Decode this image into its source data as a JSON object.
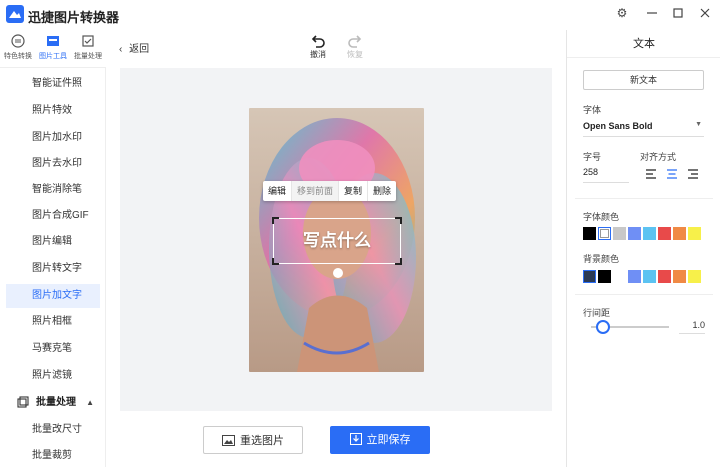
{
  "app": {
    "title": "迅捷图片转换器"
  },
  "tooltabs": [
    {
      "label": "特色转换"
    },
    {
      "label": "图片工具"
    },
    {
      "label": "批量处理"
    }
  ],
  "sidebar": {
    "items": [
      "智能证件照",
      "照片特效",
      "图片加水印",
      "图片去水印",
      "智能消除笔",
      "图片合成GIF",
      "图片编辑",
      "图片转文字",
      "图片加文字",
      "照片相框",
      "马赛克笔",
      "照片滤镜"
    ],
    "active_index": 8,
    "group_label": "批量处理",
    "group_items": [
      "批量改尺寸",
      "批量裁剪"
    ]
  },
  "toolbar": {
    "back_label": "返回",
    "undo_label": "撤消",
    "redo_label": "恢复"
  },
  "canvas": {
    "menu": {
      "edit": "编辑",
      "bring_front": "移到前面",
      "copy": "复制",
      "delete": "删除"
    },
    "text": "写点什么"
  },
  "actions": {
    "reselect_label": "重选图片",
    "save_label": "立即保存"
  },
  "panel": {
    "title": "文本",
    "new_text_label": "新文本",
    "font_label": "字体",
    "font_value": "Open Sans Bold",
    "size_label": "字号",
    "size_value": "258",
    "align_label": "对齐方式",
    "font_color_label": "字体颜色",
    "bg_color_label": "背景颜色",
    "line_spacing_label": "行间距",
    "line_spacing_value": "1.0",
    "font_colors": [
      "#000000",
      "#ffffff",
      "#c8c8c8",
      "#6f8ff5",
      "#5cc3f2",
      "#e84a4a",
      "#f08a45",
      "#f7f04a"
    ],
    "bg_colors": [
      "#2b3a55",
      "#000000",
      "#ffffff",
      "#6f8ff5",
      "#5cc3f2",
      "#e84a4a",
      "#f08a45",
      "#f7f04a"
    ],
    "accent": "#2a6df5"
  }
}
